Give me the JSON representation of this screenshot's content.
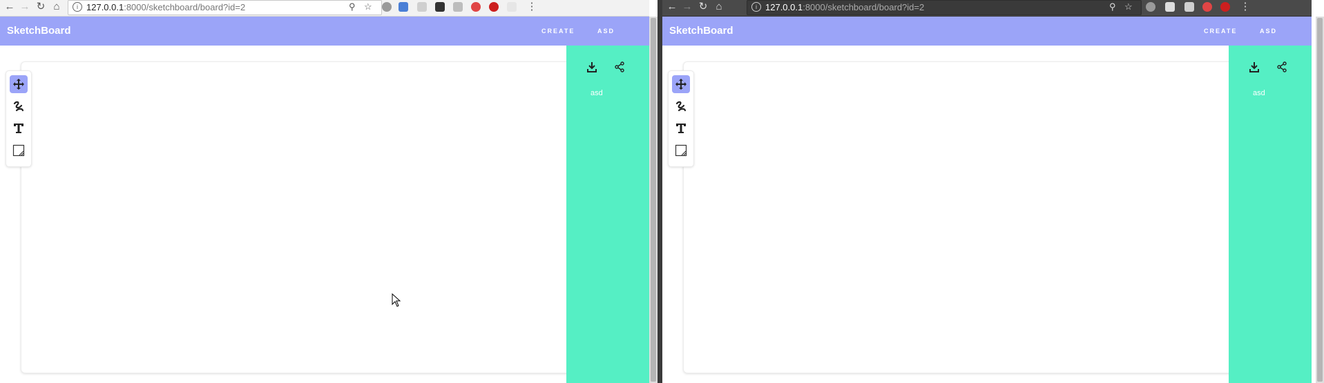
{
  "browser": {
    "url_host": "127.0.0.1",
    "url_rest": ":8000/sketchboard/board?id=2",
    "info_glyph": "i"
  },
  "app": {
    "brand": "SketchBoard",
    "nav": [
      "CREATE",
      "ASD"
    ],
    "tools": [
      "move-icon",
      "draw-icon",
      "text-icon",
      "resize-icon"
    ],
    "panel": {
      "username": "asd",
      "icons": [
        "download-icon",
        "share-icon"
      ]
    },
    "colors": {
      "appbar": "#9ba4f8",
      "panel": "#55efc4",
      "active_tool": "#9ba4f8"
    }
  }
}
